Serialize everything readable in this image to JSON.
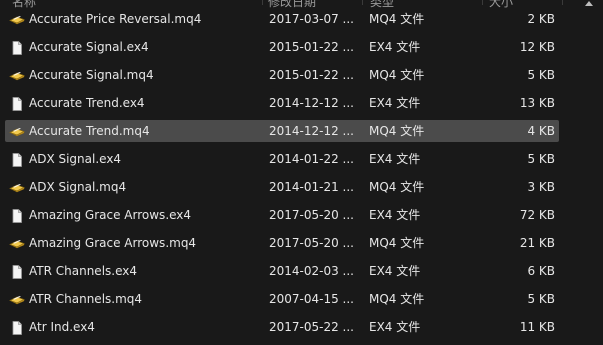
{
  "header": {
    "col_name": "名称",
    "col_date": "修改日期",
    "col_type": "类型",
    "col_size": "大小"
  },
  "files": [
    {
      "name": "Accurate Price Reversal.mq4",
      "date": "2017-03-07 ...",
      "type": "MQ4 文件",
      "size": "2 KB",
      "icon": "mq4-file-icon",
      "selected": false
    },
    {
      "name": "Accurate Signal.ex4",
      "date": "2015-01-22 ...",
      "type": "EX4 文件",
      "size": "12 KB",
      "icon": "ex4-file-icon",
      "selected": false
    },
    {
      "name": "Accurate Signal.mq4",
      "date": "2015-01-22 ...",
      "type": "MQ4 文件",
      "size": "5 KB",
      "icon": "mq4-file-icon",
      "selected": false
    },
    {
      "name": "Accurate Trend.ex4",
      "date": "2014-12-12 ...",
      "type": "EX4 文件",
      "size": "13 KB",
      "icon": "ex4-file-icon",
      "selected": false
    },
    {
      "name": "Accurate Trend.mq4",
      "date": "2014-12-12 ...",
      "type": "MQ4 文件",
      "size": "4 KB",
      "icon": "mq4-file-icon",
      "selected": true
    },
    {
      "name": "ADX Signal.ex4",
      "date": "2014-01-22 ...",
      "type": "EX4 文件",
      "size": "5 KB",
      "icon": "ex4-file-icon",
      "selected": false
    },
    {
      "name": "ADX Signal.mq4",
      "date": "2014-01-21 ...",
      "type": "MQ4 文件",
      "size": "3 KB",
      "icon": "mq4-file-icon",
      "selected": false
    },
    {
      "name": "Amazing Grace Arrows.ex4",
      "date": "2017-05-20 ...",
      "type": "EX4 文件",
      "size": "72 KB",
      "icon": "ex4-file-icon",
      "selected": false
    },
    {
      "name": "Amazing Grace Arrows.mq4",
      "date": "2017-05-20 ...",
      "type": "MQ4 文件",
      "size": "21 KB",
      "icon": "mq4-file-icon",
      "selected": false
    },
    {
      "name": "ATR Channels.ex4",
      "date": "2014-02-03 ...",
      "type": "EX4 文件",
      "size": "6 KB",
      "icon": "ex4-file-icon",
      "selected": false
    },
    {
      "name": "ATR Channels.mq4",
      "date": "2007-04-15 ...",
      "type": "MQ4 文件",
      "size": "5 KB",
      "icon": "mq4-file-icon",
      "selected": false
    },
    {
      "name": "Atr Ind.ex4",
      "date": "2017-05-22 ...",
      "type": "EX4 文件",
      "size": "11 KB",
      "icon": "ex4-file-icon",
      "selected": false
    }
  ]
}
